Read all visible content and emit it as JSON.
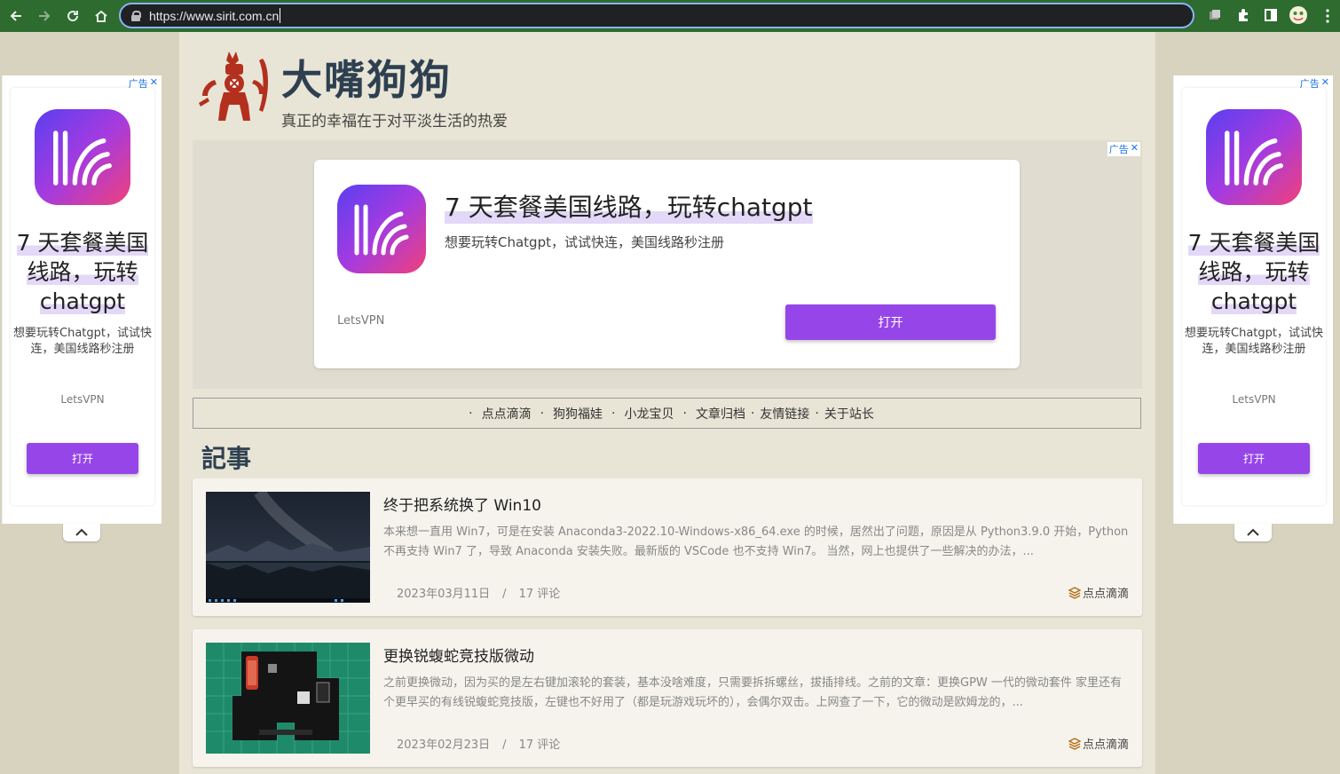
{
  "browser": {
    "url": "https://www.sirit.com.cn"
  },
  "site": {
    "title": "大嘴狗狗",
    "subtitle": "真正的幸福在于对平淡生活的热爱"
  },
  "ad_label": "广告",
  "ad_close": "✕",
  "banner_ad": {
    "headline": "7 天套餐美国线路，玩转chatgpt",
    "description": "想要玩转Chatgpt，试试快连，美国线路秒注册",
    "brand": "LetsVPN",
    "button": "打开"
  },
  "side_ad": {
    "headline_lines": [
      "7 天套餐美国",
      "线路，玩转",
      "chatgpt"
    ],
    "description": "想要玩转Chatgpt，试试快连，美国线路秒注册",
    "brand": "LetsVPN",
    "button": "打开"
  },
  "nav": {
    "items": [
      "点点滴滴",
      "狗狗福娃",
      "小龙宝贝",
      "文章归档",
      "友情链接",
      "关于站长"
    ]
  },
  "section_title": "記事",
  "posts": [
    {
      "title": "终于把系统换了 Win10",
      "excerpt": "本来想一直用 Win7，可是在安装 Anaconda3-2022.10-Windows-x86_64.exe 的时候，居然出了问题，原因是从 Python3.9.0 开始，Python不再支持 Win7 了，导致 Anaconda 安装失败。最新版的 VSCode 也不支持 Win7。 当然，网上也提供了一些解决的办法，...",
      "date": "2023年03月11日",
      "comments": "17 评论",
      "category": "点点滴滴"
    },
    {
      "title": "更换锐蝮蛇竞技版微动",
      "excerpt": "之前更换微动，因为买的是左右键加滚轮的套装，基本没啥难度，只需要拆拆螺丝，拔插排线。之前的文章：更换GPW 一代的微动套件 家里还有个更早买的有线锐蝮蛇竞技版，左键也不好用了（都是玩游戏玩坏的），会偶尔双击。上网查了一下，它的微动是欧姆龙的，...",
      "date": "2023年02月23日",
      "comments": "17 评论",
      "category": "点点滴滴"
    }
  ],
  "colors": {
    "accent_button": "#9646e8",
    "browser_frame": "#2d6b2f",
    "page_bg": "#e8e5d6",
    "title_color": "#2e4050"
  }
}
